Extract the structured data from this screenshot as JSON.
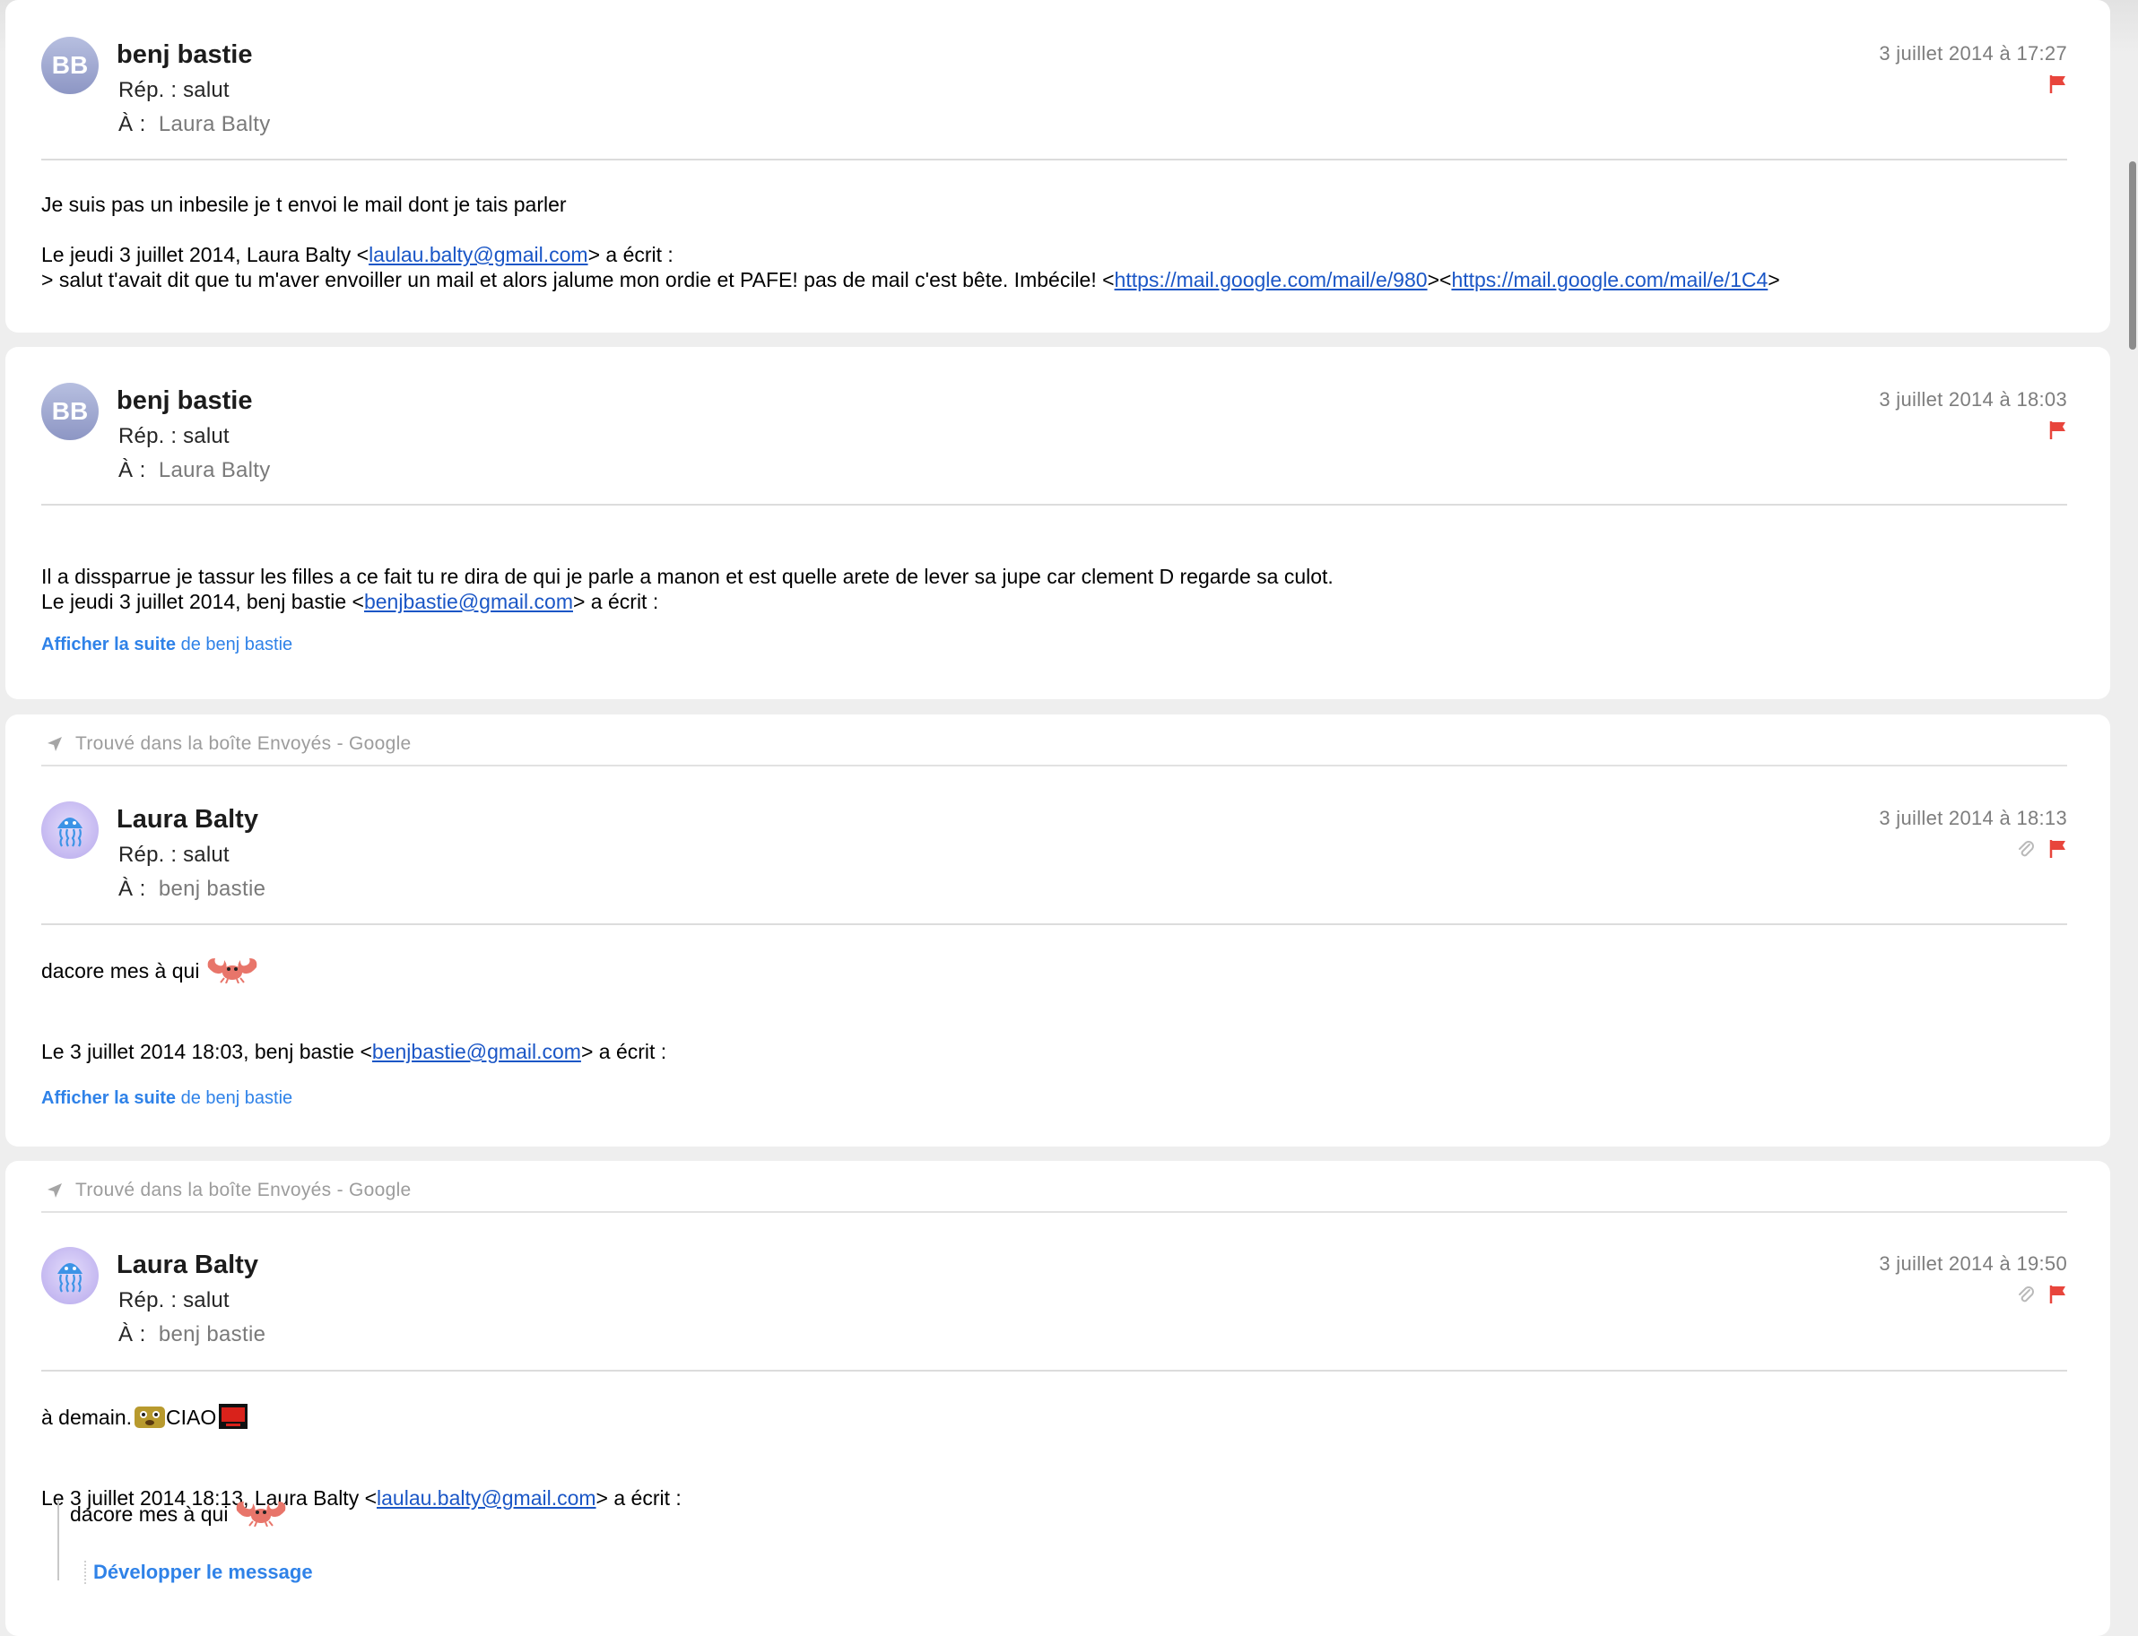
{
  "found_label": "Trouvé dans la boîte Envoyés - Google",
  "colors": {
    "flag": "#e8453c",
    "link": "#1a56c6",
    "accent": "#2f82e8"
  },
  "messages": [
    {
      "avatar_initials": "BB",
      "sender": "benj bastie",
      "subject": "Rép. : salut",
      "to_label": "À :",
      "to_name": "Laura Balty",
      "date": "3 juillet 2014 à 17:27",
      "has_attachment": false,
      "line1": "Je suis pas un inbesile je t envoi le mail dont je tais parler",
      "quote_intro_pre": "Le jeudi 3 juillet 2014, Laura Balty <",
      "quote_intro_email": "laulau.balty@gmail.com",
      "quote_intro_post": "> a écrit :",
      "quote_line_pre": "> salut t'avait dit que tu m'aver envoiller un mail et alors jalume mon ordie et PAFE! pas de mail c'est bête. Imbécile! <",
      "link1": "https://mail.google.com/mail/e/980",
      "link_sep": "><",
      "link2": "https://mail.google.com/mail/e/1C4",
      "quote_line_end": ">"
    },
    {
      "avatar_initials": "BB",
      "sender": "benj bastie",
      "subject": "Rép. : salut",
      "to_label": "À :",
      "to_name": "Laura Balty",
      "date": "3 juillet 2014 à 18:03",
      "has_attachment": false,
      "line1": "Il a dissparrue je tassur  les filles a ce fait tu re dira de qui je parle a manon et est quelle arete de lever sa jupe car clement D regarde sa culot.",
      "quote_intro_pre": "Le jeudi 3 juillet 2014, benj bastie <",
      "quote_intro_email": "benjbastie@gmail.com",
      "quote_intro_post": "> a écrit :",
      "more_bold": "Afficher la suite",
      "more_rest": " de benj bastie"
    },
    {
      "avatar_icon": "jellyfish-icon",
      "sender": "Laura Balty",
      "subject": "Rép. : salut",
      "to_label": "À :",
      "to_name": "benj bastie",
      "date": "3 juillet 2014 à 18:13",
      "has_attachment": true,
      "line1": "dacore mes à qui",
      "line1_emoji": "crab-emoji",
      "quote_intro_pre": "Le 3 juillet 2014 18:03, benj bastie <",
      "quote_intro_email": "benjbastie@gmail.com",
      "quote_intro_post": "> a écrit :",
      "more_bold": "Afficher la suite",
      "more_rest": " de benj bastie"
    },
    {
      "avatar_icon": "jellyfish-icon",
      "sender": "Laura Balty",
      "subject": "Rép. : salut",
      "to_label": "À :",
      "to_name": "benj bastie",
      "date": "3 juillet 2014 à 19:50",
      "has_attachment": true,
      "line1_a": "à demain.",
      "line1_emoji_a": "monkey-emoji",
      "line1_b": "CIAO",
      "line1_emoji_b": "red-box-emoji",
      "quote_intro_pre": "Le 3 juillet 2014 18:13, Laura Balty <",
      "quote_intro_email": "laulau.balty@gmail.com",
      "quote_intro_post": "> a écrit :",
      "quoted_text": "dacore mes à qui",
      "expand_label": "Développer le message"
    }
  ]
}
